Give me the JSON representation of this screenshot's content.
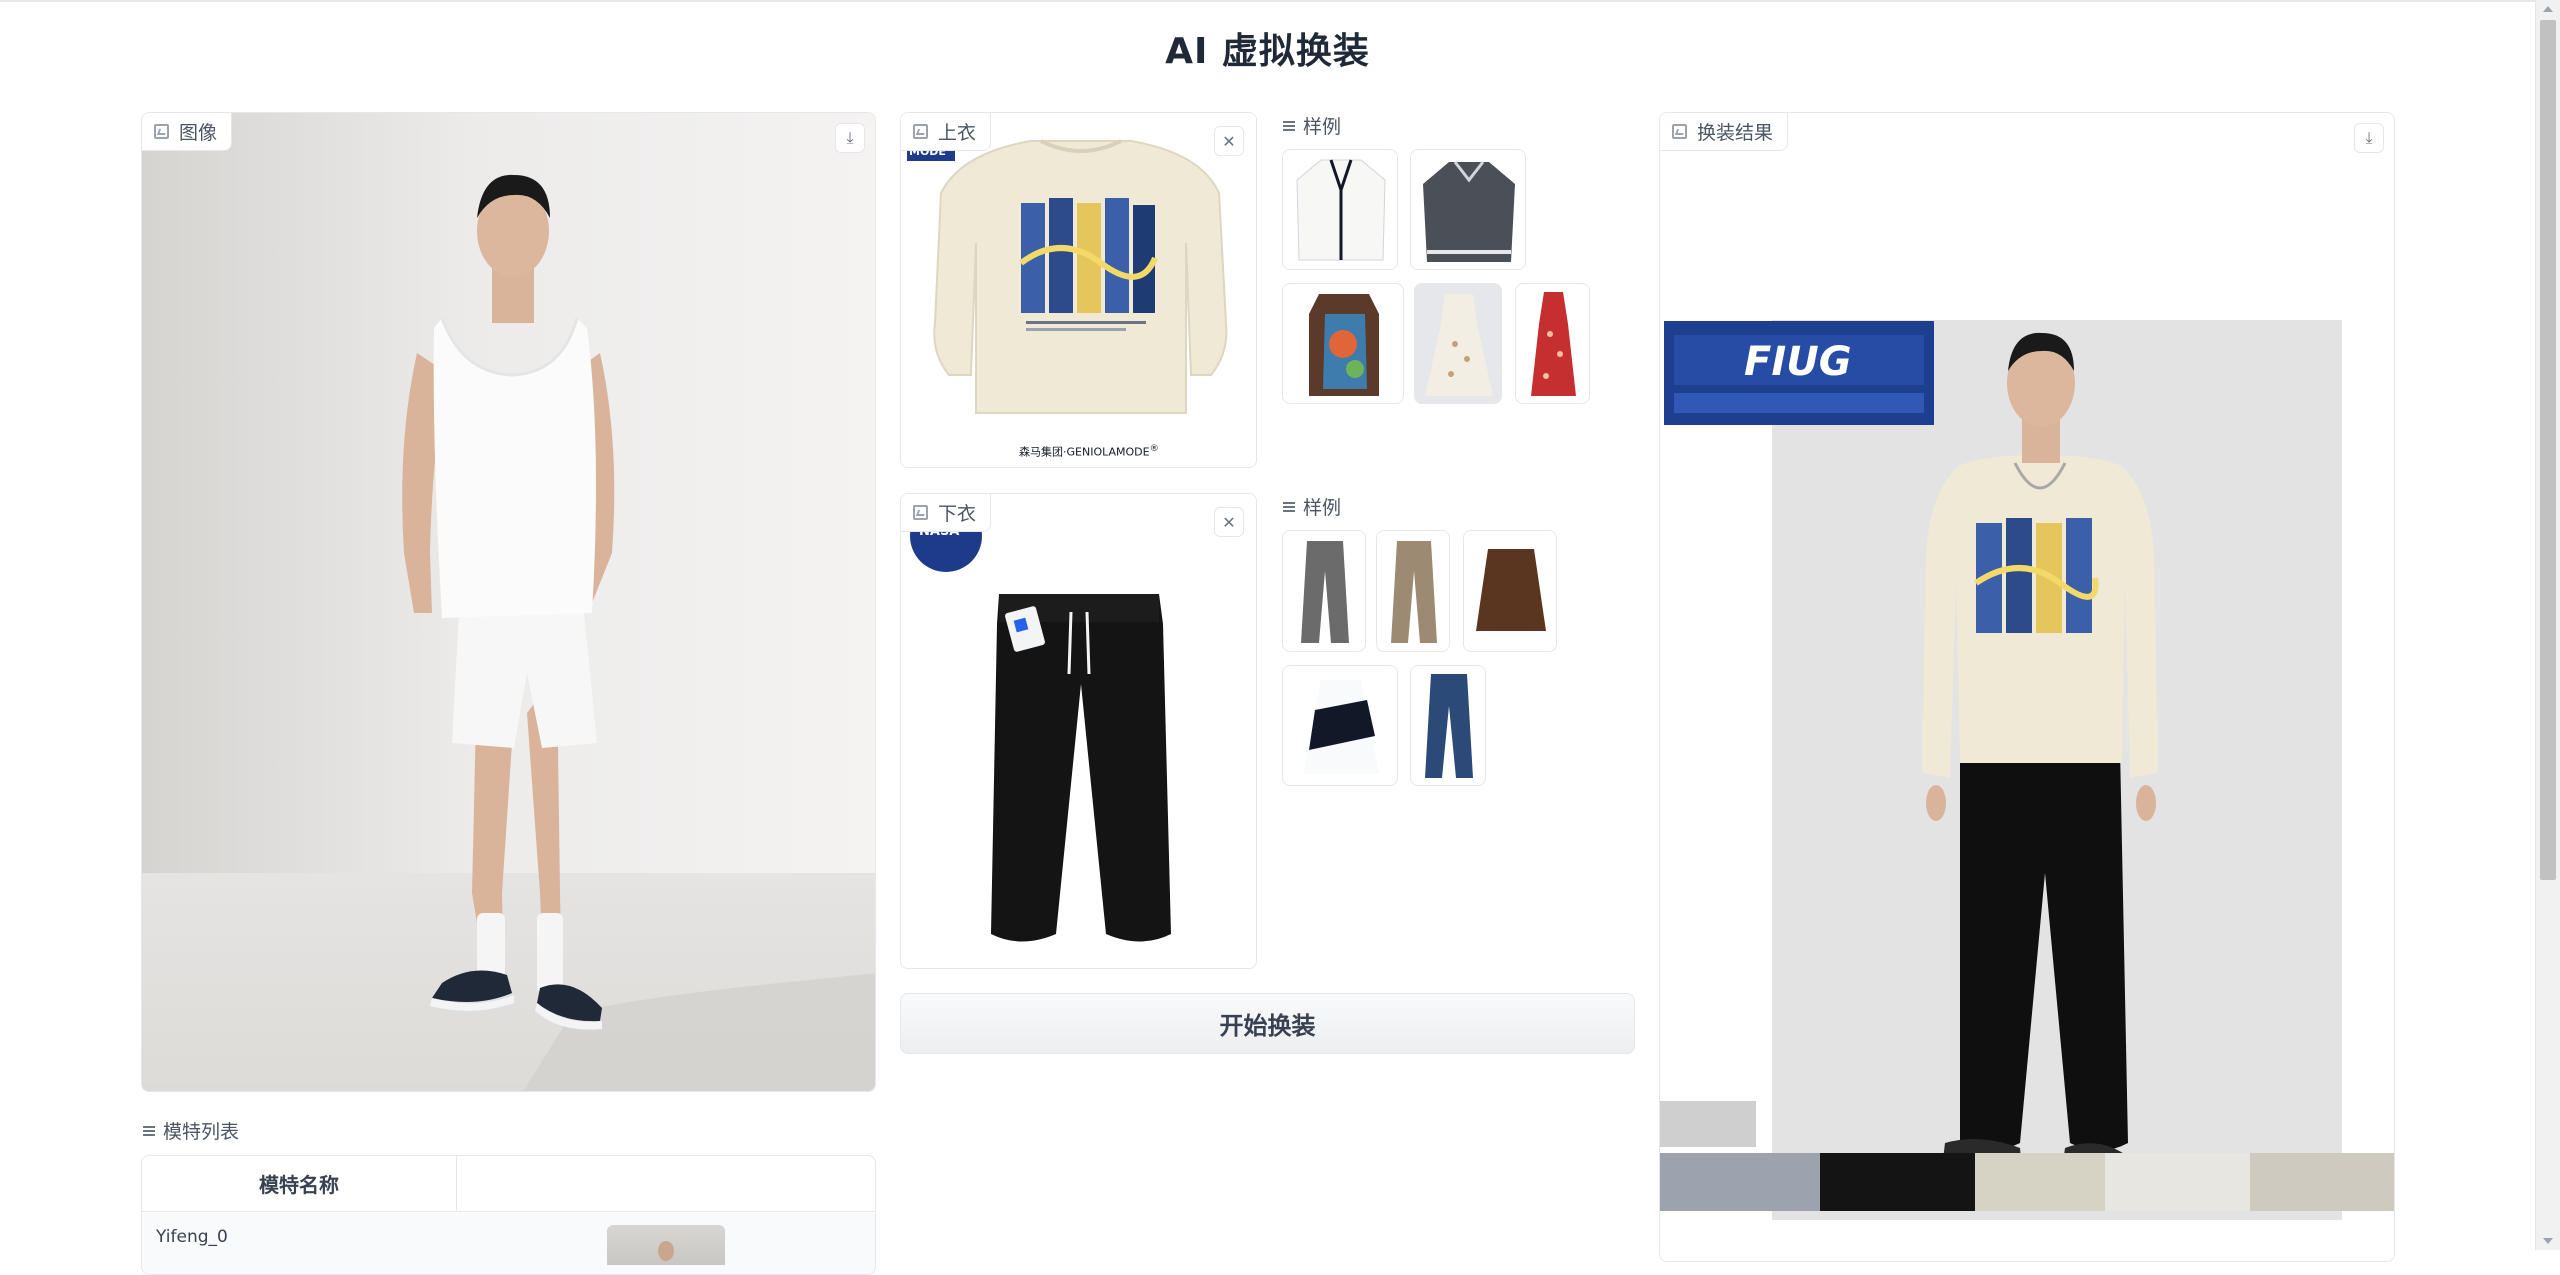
{
  "page": {
    "title": "AI 虚拟换装"
  },
  "model_image": {
    "label": "图像",
    "download_label": "⤓"
  },
  "top_garment": {
    "label": "上衣",
    "clear_label": "✕",
    "badge": "MODE",
    "brand": "森马集团·GENIOLAMODE",
    "brand_mark": "®"
  },
  "top_examples": {
    "label": "样例"
  },
  "bottom_garment": {
    "label": "下衣",
    "clear_label": "✕",
    "patch_text": "NASA"
  },
  "bottom_examples": {
    "label": "样例"
  },
  "start_button": {
    "label": "开始换装"
  },
  "result": {
    "label": "换装结果",
    "download_label": "⤓",
    "overlay_text": "FIUG"
  },
  "model_list": {
    "label": "模特列表",
    "columns": [
      "模特名称",
      ""
    ],
    "rows": [
      {
        "name": "Yifeng_0"
      }
    ]
  },
  "colors": {
    "accent": "#1f2937",
    "border": "#e5e7eb",
    "label_text": "#4b5563"
  }
}
